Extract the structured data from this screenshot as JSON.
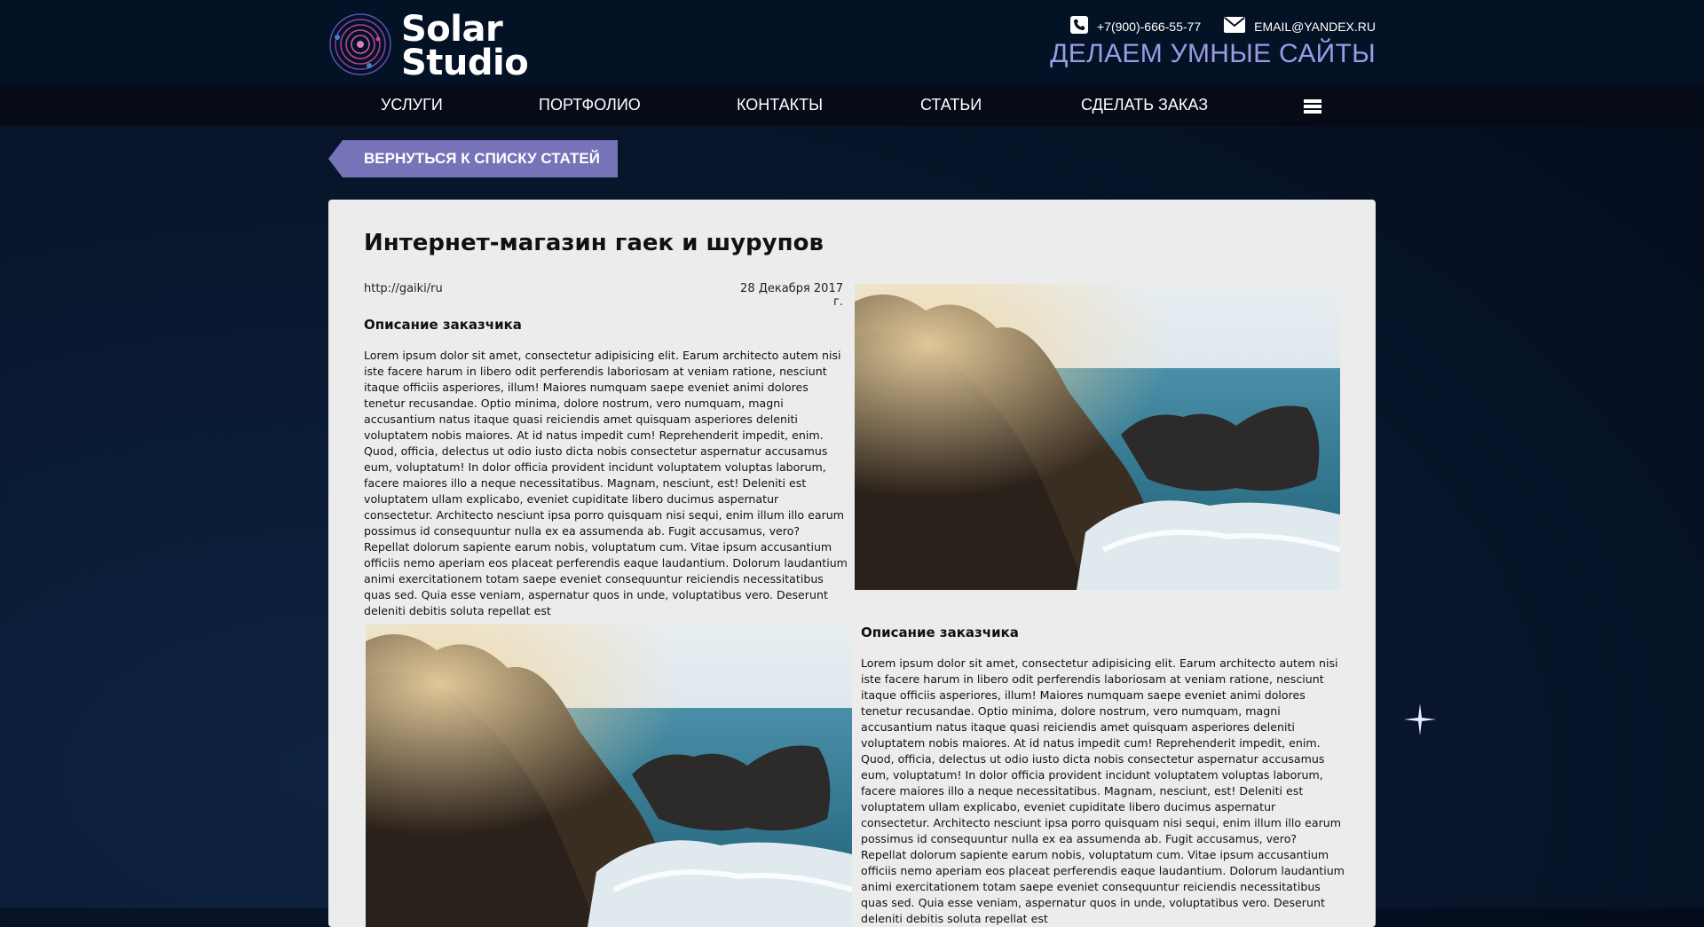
{
  "header": {
    "logo_line1": "Solar",
    "logo_line2": "Studio",
    "phone": "+7(900)-666-55-77",
    "email": "EMAIL@YANDEX.RU",
    "tagline": "ДЕЛАЕМ УМНЫЕ САЙТЫ"
  },
  "nav": {
    "items": [
      "УСЛУГИ",
      "ПОРТФОЛИО",
      "КОНТАКТЫ",
      "СТАТЬИ",
      "СДЕЛАТЬ ЗАКАЗ"
    ]
  },
  "back_button": "ВЕРНУТЬСЯ К СПИСКУ СТАТЕЙ",
  "article": {
    "title": "Интернет-магазин гаек и шурупов",
    "url": "http://gaiki/ru",
    "date": "28 Декабря 2017 г.",
    "section1": {
      "heading": "Описание заказчика",
      "text": "Lorem ipsum dolor sit amet, consectetur adipisicing elit. Earum architecto autem nisi iste facere harum in libero odit perferendis laboriosam at veniam ratione, nesciunt itaque officiis asperiores, illum! Maiores numquam saepe eveniet animi dolores tenetur recusandae. Optio minima, dolore nostrum, vero numquam, magni accusantium natus itaque quasi reiciendis amet quisquam asperiores deleniti voluptatem nobis maiores. At id natus impedit cum! Reprehenderit impedit, enim. Quod, officia, delectus ut odio iusto dicta nobis consectetur aspernatur accusamus eum, voluptatum! In dolor officia provident incidunt voluptatem voluptas laborum, facere maiores illo a neque necessitatibus. Magnam, nesciunt, est! Deleniti est voluptatem ullam explicabo, eveniet cupiditate libero ducimus aspernatur consectetur. Architecto nesciunt ipsa porro quisquam nisi sequi, enim illum illo earum possimus id consequuntur nulla ex ea assumenda ab. Fugit accusamus, vero? Repellat dolorum sapiente earum nobis, voluptatum cum. Vitae ipsum accusantium officiis nemo aperiam eos placeat perferendis eaque laudantium. Dolorum laudantium animi exercitationem totam saepe eveniet consequuntur reiciendis necessitatibus quas sed. Quia esse veniam, aspernatur quos in unde, voluptatibus vero. Deserunt deleniti debitis soluta repellat est"
    },
    "section2": {
      "heading": "Описание заказчика",
      "text": "Lorem ipsum dolor sit amet, consectetur adipisicing elit. Earum architecto autem nisi iste facere harum in libero odit perferendis laboriosam at veniam ratione, nesciunt itaque officiis asperiores, illum! Maiores numquam saepe eveniet animi dolores tenetur recusandae. Optio minima, dolore nostrum, vero numquam, magni accusantium natus itaque quasi reiciendis amet quisquam asperiores deleniti voluptatem nobis maiores. At id natus impedit cum! Reprehenderit impedit, enim. Quod, officia, delectus ut odio iusto dicta nobis consectetur aspernatur accusamus eum, voluptatum! In dolor officia provident incidunt voluptatem voluptas laborum, facere maiores illo a neque necessitatibus. Magnam, nesciunt, est! Deleniti est voluptatem ullam explicabo, eveniet cupiditate libero ducimus aspernatur consectetur. Architecto nesciunt ipsa porro quisquam nisi sequi, enim illum illo earum possimus id consequuntur nulla ex ea assumenda ab. Fugit accusamus, vero? Repellat dolorum sapiente earum nobis, voluptatum cum. Vitae ipsum accusantium officiis nemo aperiam eos placeat perferendis eaque laudantium. Dolorum laudantium animi exercitationem totam saepe eveniet consequuntur reiciendis necessitatibus quas sed. Quia esse veniam, aspernatur quos in unde, voluptatibus vero. Deserunt deleniti debitis soluta repellat est"
    }
  },
  "colors": {
    "accent": "#7773b8",
    "tagline": "#9b9be6",
    "header_bg": "#041226",
    "nav_bg": "#070b18",
    "card_bg": "#ececec"
  },
  "icons": [
    "solar-logo-icon",
    "phone-icon",
    "mail-icon",
    "menu-icon",
    "star-icon"
  ]
}
